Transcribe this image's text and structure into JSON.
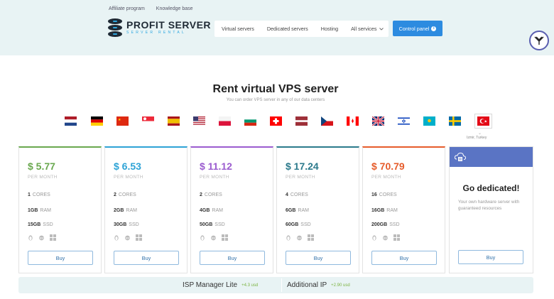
{
  "header": {
    "top_links": [
      "Affiliate program",
      "Knowledge base"
    ],
    "logo_title": "PROFIT SERVER",
    "logo_subtitle": "SERVER RENTAL",
    "nav": [
      "Virtual servers",
      "Dedicated servers",
      "Hosting",
      "All services"
    ],
    "nav_dropdown_icon": "chevron-down-icon",
    "control_panel": "Control panel",
    "control_panel_icon": "info-icon"
  },
  "main": {
    "title": "Rent virtual VPS server",
    "subtitle": "You can order VPS server in any of our data centers"
  },
  "flags": {
    "countries": [
      "Netherlands",
      "Germany",
      "China",
      "Singapore",
      "Spain",
      "USA",
      "Poland",
      "Bulgaria",
      "Switzerland",
      "Latvia",
      "Czech Republic",
      "Canada",
      "United Kingdom",
      "Israel",
      "Kazakhstan",
      "Sweden",
      "Turkey"
    ],
    "selected_label": "Izmir, Turkey"
  },
  "plans": [
    {
      "price": "$ 5.77",
      "per": "PER MONTH",
      "cores": "1",
      "cores_label": "CORES",
      "ram": "1GB",
      "ram_label": "RAM",
      "ssd": "15GB",
      "ssd_label": "SSD",
      "buy": "Buy",
      "color": "#6aa84f"
    },
    {
      "price": "$ 6.53",
      "per": "PER MONTH",
      "cores": "2",
      "cores_label": "CORES",
      "ram": "2GB",
      "ram_label": "RAM",
      "ssd": "30GB",
      "ssd_label": "SSD",
      "buy": "Buy",
      "color": "#2ea3d6"
    },
    {
      "price": "$ 11.12",
      "per": "PER MONTH",
      "cores": "2",
      "cores_label": "CORES",
      "ram": "4GB",
      "ram_label": "RAM",
      "ssd": "50GB",
      "ssd_label": "SSD",
      "buy": "Buy",
      "color": "#9b5ccf"
    },
    {
      "price": "$ 17.24",
      "per": "PER MONTH",
      "cores": "4",
      "cores_label": "CORES",
      "ram": "6GB",
      "ram_label": "RAM",
      "ssd": "60GB",
      "ssd_label": "SSD",
      "buy": "Buy",
      "color": "#2c7a8c"
    },
    {
      "price": "$ 70.79",
      "per": "PER MONTH",
      "cores": "16",
      "cores_label": "CORES",
      "ram": "16GB",
      "ram_label": "RAM",
      "ssd": "200GB",
      "ssd_label": "SSD",
      "buy": "Buy",
      "color": "#e65c2b"
    }
  ],
  "dedicated": {
    "title": "Go dedicated!",
    "text": "Your own hardware server with guaranteed resources",
    "buy": "Buy",
    "icon": "server-cloud-icon"
  },
  "addons": [
    {
      "name": "ISP Manager Lite",
      "extra": "+4.3 usd"
    },
    {
      "name": "Additional IP",
      "extra": "+2.90 usd"
    }
  ]
}
